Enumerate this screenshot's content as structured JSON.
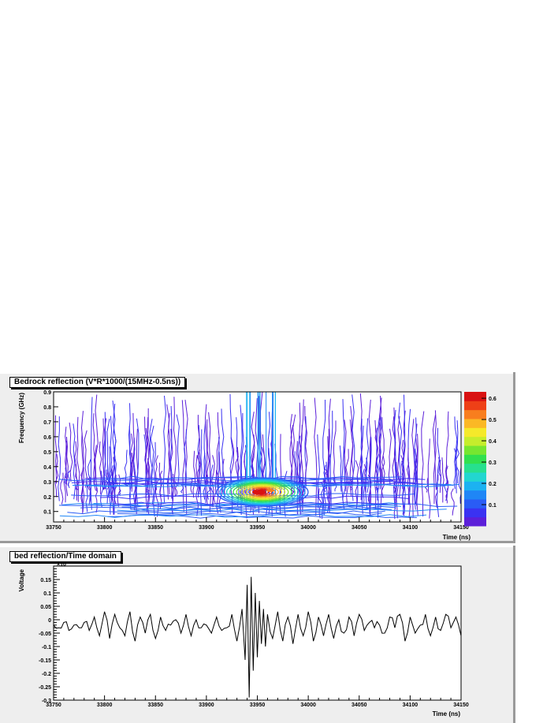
{
  "top_panel": {
    "title": "Bedrock reflection (V*R*1000/(15MHz-0.5ns))"
  },
  "bottom_panel": {
    "title": "bed reflection/Time domain"
  },
  "chart_data": [
    {
      "type": "heatmap",
      "style": "contour",
      "title": "Bedrock reflection (V*R*1000/(15MHz-0.5ns))",
      "xlabel": "Time (ns)",
      "ylabel": "Frequency (GHz)",
      "xlim": [
        33750,
        34150
      ],
      "ylim": [
        0.03,
        0.9
      ],
      "xticks": [
        "33750",
        "33800",
        "33850",
        "33900",
        "33950",
        "34000",
        "34050",
        "34100",
        "34150"
      ],
      "yticks": [
        "0.1",
        "0.2",
        "0.3",
        "0.4",
        "0.5",
        "0.6",
        "0.7",
        "0.8",
        "0.9"
      ],
      "zlim": [
        0,
        0.63
      ],
      "zticks": [
        "0.1",
        "0.2",
        "0.3",
        "0.4",
        "0.5",
        "0.6"
      ],
      "peak": {
        "x": 33955,
        "y": 0.23,
        "z": 0.6
      },
      "colorbar": [
        "#5c1fd9",
        "#3a32f2",
        "#2a5cf5",
        "#1f86f6",
        "#1cb2f1",
        "#22d6d0",
        "#27e08e",
        "#31e04e",
        "#77e630",
        "#c6ed2c",
        "#f5e92a",
        "#fbb825",
        "#f87e1e",
        "#ee4017",
        "#d91212"
      ],
      "legend_position": "right"
    },
    {
      "type": "line",
      "title": "bed reflection/Time domain",
      "xlabel": "Time (ns)",
      "ylabel": "Voltage",
      "exponent_label": "×10",
      "xlim": [
        33750,
        34150
      ],
      "ylim": [
        -0.3,
        0.2
      ],
      "xticks": [
        "33750",
        "33800",
        "33850",
        "33900",
        "33950",
        "34000",
        "34050",
        "34100",
        "34150"
      ],
      "yticks": [
        "0.15",
        "0.1",
        "0.05",
        "0",
        "-0.05",
        "-0.1",
        "-0.15",
        "-0.2",
        "-0.25",
        "-0.3"
      ],
      "yticks_values": [
        0.15,
        0.1,
        0.05,
        0,
        -0.05,
        -0.1,
        -0.15,
        -0.2,
        -0.25,
        -0.3
      ],
      "series": [
        {
          "x": [
            33750,
            33755,
            33760,
            33765,
            33770,
            33775,
            33780,
            33785,
            33790,
            33795,
            33800,
            33805,
            33810,
            33815,
            33820,
            33825,
            33830,
            33835,
            33840,
            33845,
            33850,
            33855,
            33860,
            33865,
            33870,
            33875,
            33880,
            33885,
            33890,
            33895,
            33900,
            33905,
            33910,
            33915,
            33920,
            33925,
            33930,
            33935,
            33938,
            33940,
            33942,
            33944,
            33946,
            33948,
            33950,
            33952,
            33954,
            33956,
            33958,
            33960,
            33965,
            33970,
            33975,
            33980,
            33985,
            33990,
            33995,
            34000,
            34005,
            34010,
            34015,
            34020,
            34025,
            34030,
            34035,
            34040,
            34045,
            34050,
            34055,
            34060,
            34065,
            34070,
            34075,
            34080,
            34085,
            34090,
            34095,
            34100,
            34105,
            34110,
            34115,
            34120,
            34125,
            34130,
            34135,
            34140,
            34145,
            34150
          ],
          "y": [
            -0.02,
            -0.03,
            -0.01,
            -0.04,
            -0.02,
            -0.03,
            -0.01,
            -0.04,
            0.01,
            -0.06,
            0.03,
            -0.07,
            0.02,
            -0.03,
            -0.06,
            0.03,
            -0.08,
            0.01,
            -0.05,
            0.02,
            -0.07,
            0.01,
            -0.04,
            -0.02,
            0.0,
            -0.05,
            0.02,
            -0.06,
            0.0,
            -0.03,
            -0.02,
            -0.05,
            0.01,
            -0.04,
            -0.03,
            0.02,
            -0.08,
            0.04,
            -0.15,
            0.13,
            -0.29,
            0.16,
            -0.19,
            0.1,
            -0.14,
            0.07,
            -0.09,
            0.04,
            -0.1,
            0.02,
            -0.07,
            0.03,
            -0.08,
            0.01,
            -0.09,
            0.02,
            -0.06,
            0.03,
            -0.08,
            0.01,
            -0.06,
            0.02,
            -0.07,
            0.0,
            -0.05,
            0.01,
            -0.06,
            0.02,
            -0.04,
            -0.01,
            -0.03,
            -0.02,
            -0.05,
            0.01,
            -0.03,
            0.02,
            -0.08,
            0.01,
            -0.05,
            -0.02,
            0.02,
            -0.06,
            0.01,
            -0.04,
            0.02,
            -0.03,
            0.01,
            -0.06
          ]
        }
      ]
    }
  ]
}
